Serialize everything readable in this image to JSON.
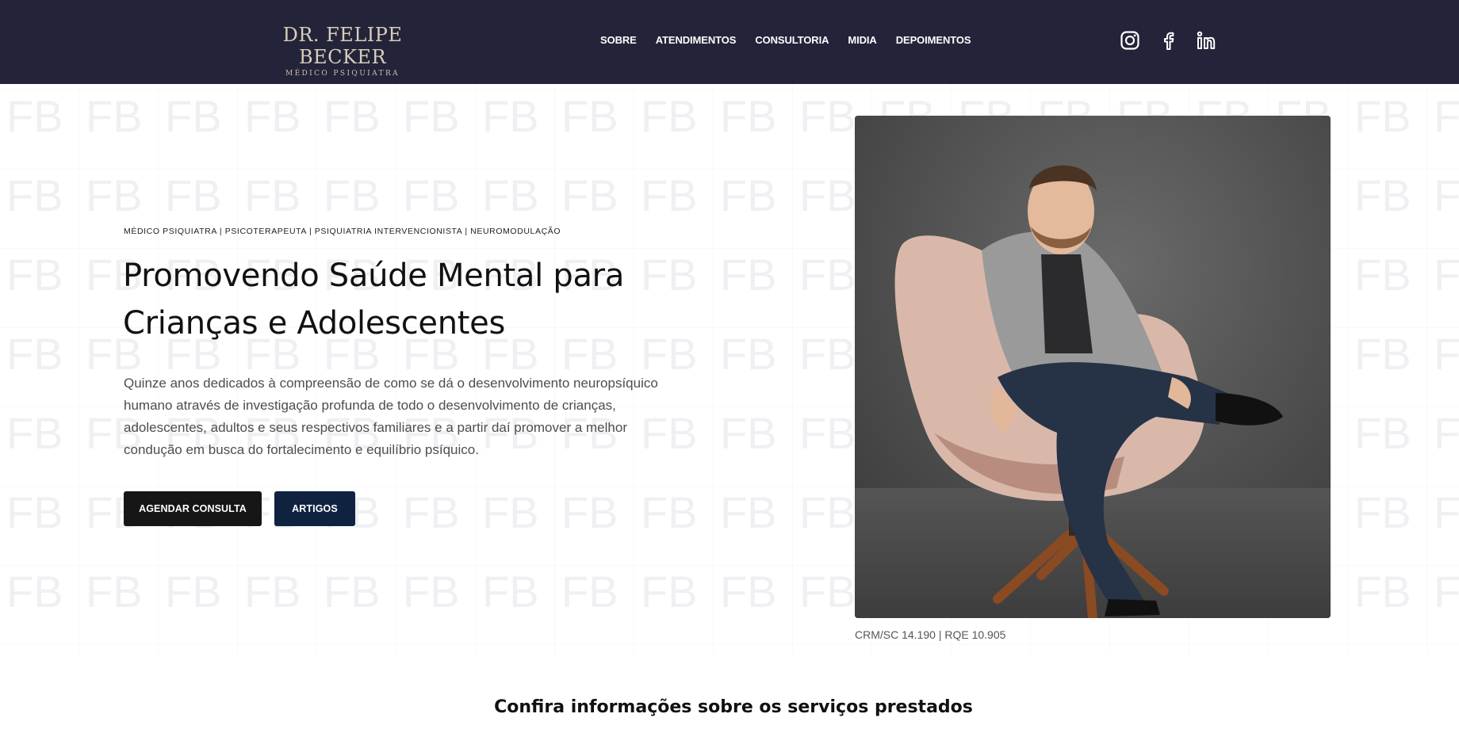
{
  "header": {
    "logo_name": "DR. FELIPE BECKER",
    "logo_subtitle": "MÉDICO PSIQUIATRA",
    "nav": [
      "SOBRE",
      "ATENDIMENTOS",
      "CONSULTORIA",
      "MIDIA",
      "DEPOIMENTOS"
    ],
    "social_icons": [
      "instagram-icon",
      "facebook-icon",
      "linkedin-icon"
    ],
    "background": "#232439"
  },
  "hero": {
    "watermark": "FB",
    "tagline": "MÉDICO PSIQUIATRA | PSICOTERAPEUTA | PSIQUIATRIA INTERVENCIONISTA | NEUROMODULAÇÃO",
    "headline": "Promovendo Saúde Mental para Crianças e Adolescentes",
    "description": "Quinze anos dedicados à compreensão de como se dá o desenvolvimento neuropsíquico humano através de investigação profunda de todo o desenvolvimento de crianças, adolescentes, adultos e seus respectivos familiares e a partir daí promover a melhor condução em busca do fortalecimento e equilíbrio psíquico.",
    "buttons": {
      "primary": "AGENDAR CONSULTA",
      "secondary": "ARTIGOS"
    },
    "credential": "CRM/SC 14.190 | RQE 10.905"
  },
  "services": {
    "title": "Confira informações sobre os serviços prestados"
  },
  "colors": {
    "primary_button": "#161616",
    "secondary_button": "#0f2341"
  }
}
